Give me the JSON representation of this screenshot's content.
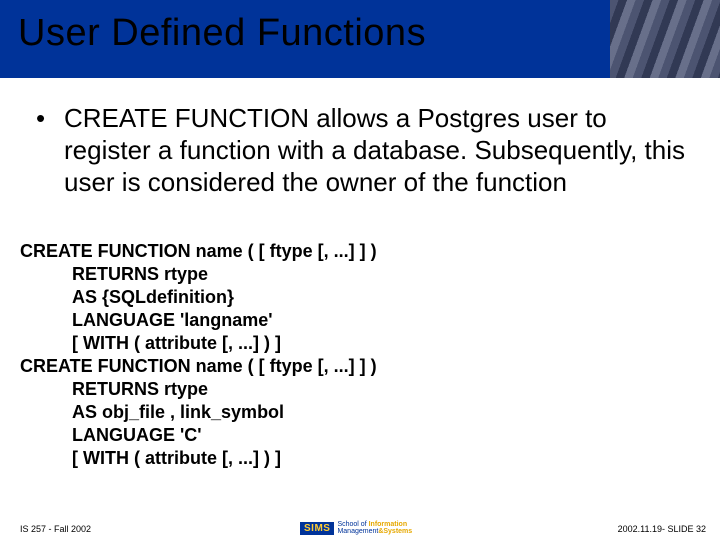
{
  "title": "User Defined Functions",
  "bullet": "CREATE FUNCTION allows a Postgres user to register a function with a database. Subsequently, this user is considered the owner of the function",
  "code": {
    "l1": "CREATE FUNCTION name ( [ ftype [, ...] ] )",
    "l2": "RETURNS rtype",
    "l3": "AS {SQLdefinition}",
    "l4": "LANGUAGE 'langname'",
    "l5": "[ WITH ( attribute [, ...] ) ]",
    "l6": "CREATE FUNCTION name ( [ ftype [, ...] ] )",
    "l7": "RETURNS rtype",
    "l8": "AS obj_file , link_symbol",
    "l9": "LANGUAGE 'C'",
    "l10": "[ WITH ( attribute [, ...] ) ]"
  },
  "footer": {
    "left": "IS 257 - Fall 2002",
    "right": "2002.11.19- SLIDE 32",
    "logo_abbr": "SIMS",
    "logo_line1": "School of Information",
    "logo_line2_a": "Management",
    "logo_line2_b": "&Systems"
  }
}
